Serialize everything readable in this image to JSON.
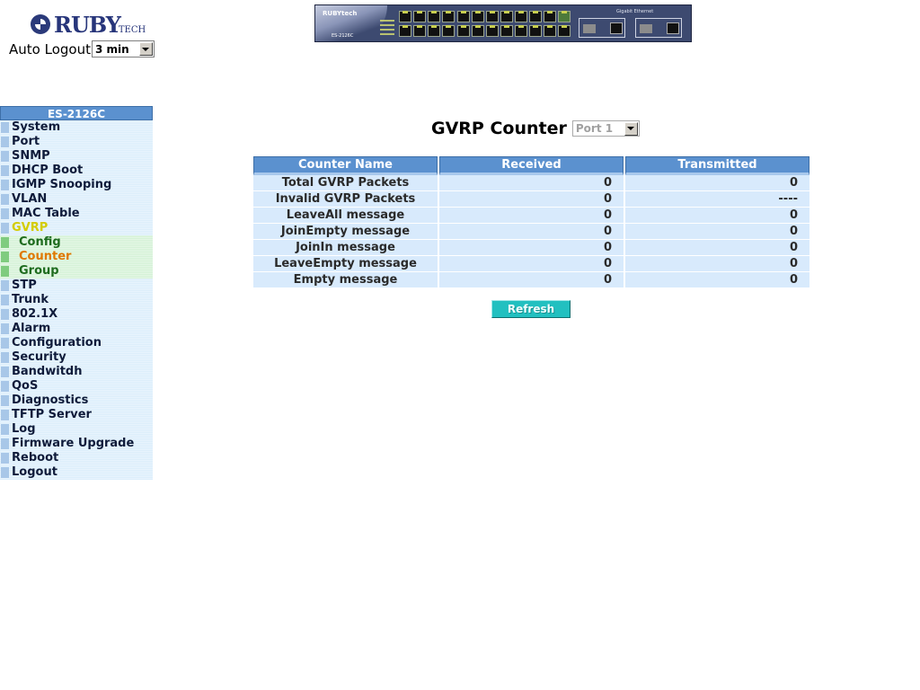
{
  "header": {
    "logo_text": "RUBY",
    "logo_tech": "TECH",
    "auto_logout_label": "Auto Logout",
    "auto_logout_value": "3 min",
    "switch_brand": "RUBYtech",
    "switch_model": "ES-2126C",
    "switch_gig_label": "Gigabit Ethernet"
  },
  "sidebar": {
    "title": "ES-2126C",
    "items": [
      {
        "label": "System"
      },
      {
        "label": "Port"
      },
      {
        "label": "SNMP"
      },
      {
        "label": "DHCP Boot"
      },
      {
        "label": "IGMP Snooping"
      },
      {
        "label": "VLAN"
      },
      {
        "label": "MAC Table"
      },
      {
        "label": "GVRP"
      },
      {
        "label": "STP"
      },
      {
        "label": "Trunk"
      },
      {
        "label": "802.1X"
      },
      {
        "label": "Alarm"
      },
      {
        "label": "Configuration"
      },
      {
        "label": "Security"
      },
      {
        "label": "Bandwitdh"
      },
      {
        "label": "QoS"
      },
      {
        "label": "Diagnostics"
      },
      {
        "label": "TFTP Server"
      },
      {
        "label": "Log"
      },
      {
        "label": "Firmware Upgrade"
      },
      {
        "label": "Reboot"
      },
      {
        "label": "Logout"
      }
    ],
    "gvrp_sub": [
      {
        "label": "Config"
      },
      {
        "label": "Counter"
      },
      {
        "label": "Group"
      }
    ]
  },
  "main": {
    "title": "GVRP Counter",
    "port_select": "Port 1",
    "table": {
      "headers": [
        "Counter Name",
        "Received",
        "Transmitted"
      ],
      "rows": [
        [
          "Total GVRP Packets",
          "0",
          "0"
        ],
        [
          "Invalid GVRP Packets",
          "0",
          "----"
        ],
        [
          "LeaveAll message",
          "0",
          "0"
        ],
        [
          "JoinEmpty message",
          "0",
          "0"
        ],
        [
          "JoinIn message",
          "0",
          "0"
        ],
        [
          "LeaveEmpty message",
          "0",
          "0"
        ],
        [
          "Empty message",
          "0",
          "0"
        ]
      ]
    },
    "refresh_label": "Refresh"
  },
  "colors": {
    "header_blue": "#5b91cf",
    "row_blue": "#d8eafc",
    "active_nav": "#d4cc00",
    "current_sub": "#e07800",
    "sub_green": "#1e6b1e",
    "button_teal": "#22c0c0"
  }
}
